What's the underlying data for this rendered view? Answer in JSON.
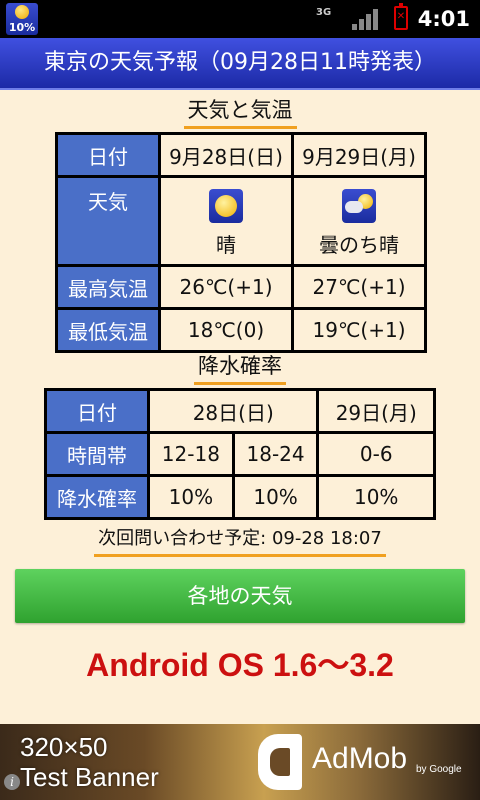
{
  "status_bar": {
    "app_battery_label": "10%",
    "network_type": "3G",
    "time": "4:01"
  },
  "title": "東京の天気予報（09月28日11時発表）",
  "weather_section": {
    "title": "天気と気温",
    "header_label": "日付",
    "dates": [
      "9月28日(日)",
      "9月29日(月)"
    ],
    "weather_label": "天気",
    "weather": [
      {
        "icon": "sunny-icon",
        "text": "晴"
      },
      {
        "icon": "cloud-then-sun-icon",
        "text": "曇のち晴"
      }
    ],
    "max_label": "最高気温",
    "max_temps": [
      "26℃(+1)",
      "27℃(+1)"
    ],
    "min_label": "最低気温",
    "min_temps": [
      "18℃(0)",
      "19℃(+1)"
    ]
  },
  "precip_section": {
    "title": "降水確率",
    "date_label": "日付",
    "dates": [
      "28日(日)",
      "29日(月)"
    ],
    "period_label": "時間帯",
    "periods": [
      "12-18",
      "18-24",
      "0-6"
    ],
    "prob_label": "降水確率",
    "probabilities": [
      "10%",
      "10%",
      "10%"
    ]
  },
  "next_query": "次回問い合わせ予定: 09-28 18:07",
  "region_button": "各地の天気",
  "os_text": "Android OS 1.6〜3.2",
  "ad": {
    "line1": "320×50",
    "line2": "Test Banner",
    "brand": "AdMob",
    "by": "by Google"
  },
  "colors": {
    "title_bar": "#2a3ac4",
    "header_cell": "#4a6fc8",
    "background": "#fdf0d8",
    "button": "#3cb43c",
    "os_text": "#cc1010",
    "underline": "#f0a020"
  }
}
